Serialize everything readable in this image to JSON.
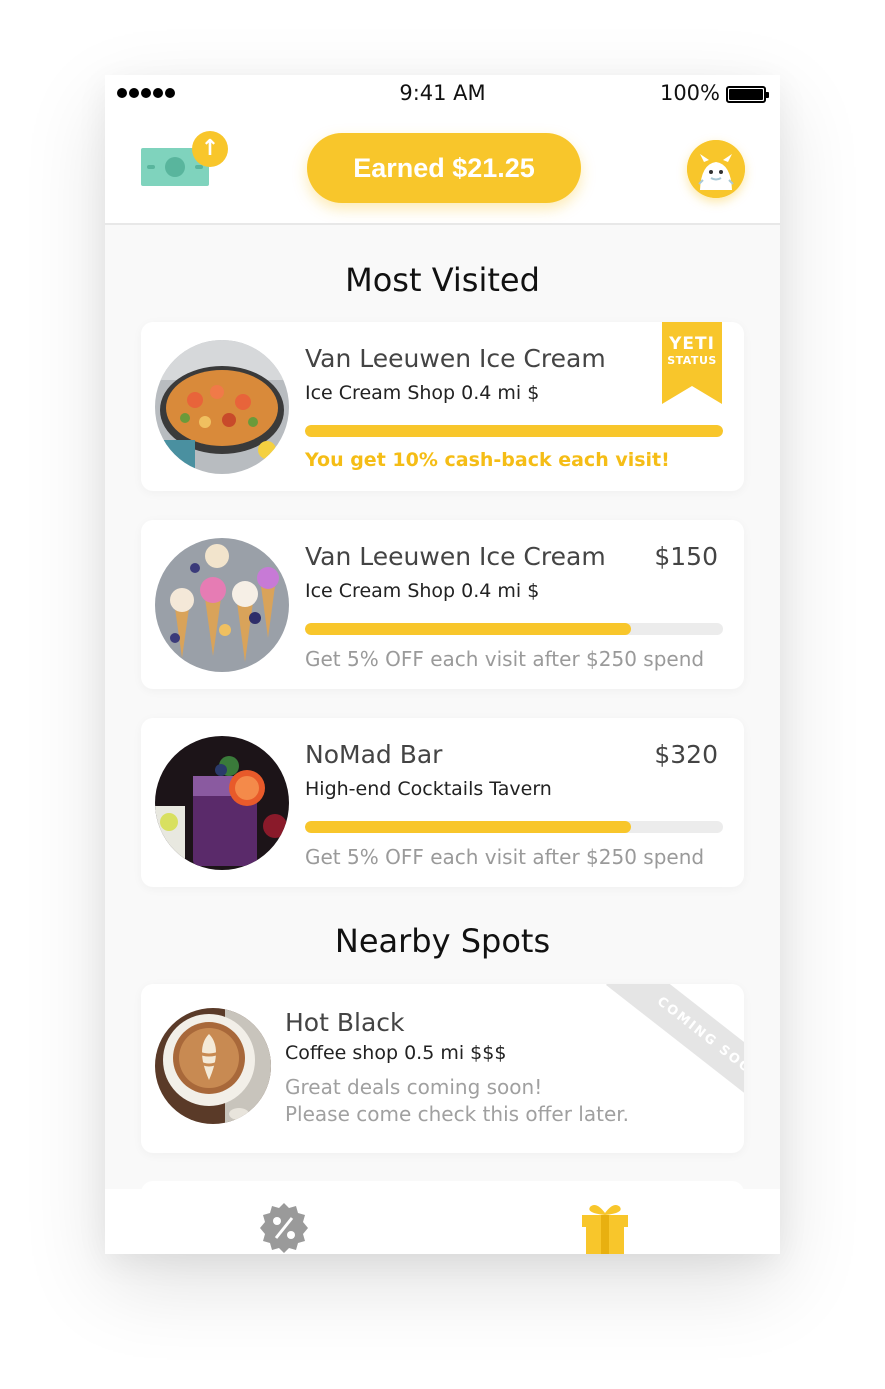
{
  "status_bar": {
    "time": "9:41 AM",
    "battery": "100%"
  },
  "header": {
    "earned_label": "Earned $21.25",
    "cashout_icon": "cash-upload-icon",
    "avatar_icon": "yeti-avatar-icon"
  },
  "most_visited": {
    "title": "Most Visited",
    "items": [
      {
        "name": "Van Leeuwen Ice Cream",
        "subtitle": "Ice Cream Shop 0.4 mi $",
        "badge_line1": "YETI",
        "badge_line2": "STATUS",
        "progress": 1.0,
        "offer": "You get 10% cash-back each visit!",
        "image": "paella-photo"
      },
      {
        "name": "Van Leeuwen Ice Cream",
        "subtitle": "Ice Cream Shop 0.4 mi $",
        "amount": "$150",
        "progress": 0.78,
        "offer": "Get 5% OFF each visit after $250 spend",
        "image": "ice-cream-cones-photo"
      },
      {
        "name": "NoMad Bar",
        "subtitle": "High-end Cocktails Tavern",
        "amount": "$320",
        "progress": 0.78,
        "offer": "Get 5% OFF each visit after $250 spend",
        "image": "cocktail-photo"
      }
    ]
  },
  "nearby": {
    "title": "Nearby Spots",
    "items": [
      {
        "name": "Hot Black",
        "subtitle": "Coffee shop 0.5 mi $$$",
        "note_line1": "Great deals coming soon!",
        "note_line2": "Please come check this offer later.",
        "banner": "COMING SOON",
        "image": "latte-photo"
      }
    ]
  },
  "tabbar": {
    "tabs": [
      {
        "icon": "percent-badge-icon"
      },
      {
        "icon": "gift-icon"
      }
    ]
  },
  "colors": {
    "accent": "#f8c62b",
    "cash_green": "#7fd3bd",
    "muted_text": "#9a9a9a"
  }
}
